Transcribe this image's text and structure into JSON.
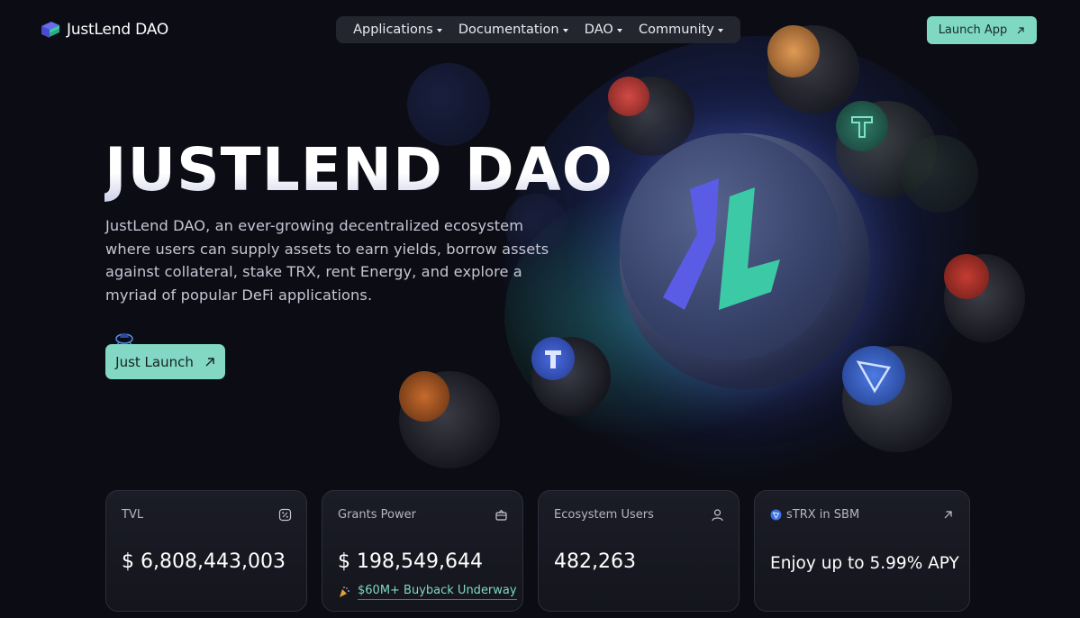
{
  "brand": {
    "name": "JustLend DAO"
  },
  "nav": {
    "items": [
      {
        "label": "Applications"
      },
      {
        "label": "Documentation"
      },
      {
        "label": "DAO"
      },
      {
        "label": "Community"
      }
    ],
    "launch_app": "Launch App"
  },
  "hero": {
    "title": "JUSTLEND DAO",
    "description": "JustLend DAO, an ever-growing decentralized ecosystem where users can supply assets to earn yields, borrow assets against collateral, stake TRX, rent Energy, and explore a myriad of popular DeFi applications.",
    "cta": "Just Launch"
  },
  "stats": {
    "tvl": {
      "label": "TVL",
      "value": "$ 6,808,443,003",
      "icon": "percent-icon"
    },
    "grants": {
      "label": "Grants Power",
      "value": "$ 198,549,644",
      "icon": "gift-icon",
      "sub": "$60M+ Buyback Underway"
    },
    "users": {
      "label": "Ecosystem Users",
      "value": "482,263",
      "icon": "user-icon"
    },
    "strx": {
      "label": "sTRX in SBM",
      "value": "Enjoy up to 5.99% APY",
      "icon": "arrow-up-right-icon"
    }
  },
  "colors": {
    "accent": "#7fd9c2",
    "background": "#0b0c14",
    "nav_bg": "#23252f",
    "logo_purple": "#5b5ce6",
    "logo_teal": "#3cc9a6"
  }
}
